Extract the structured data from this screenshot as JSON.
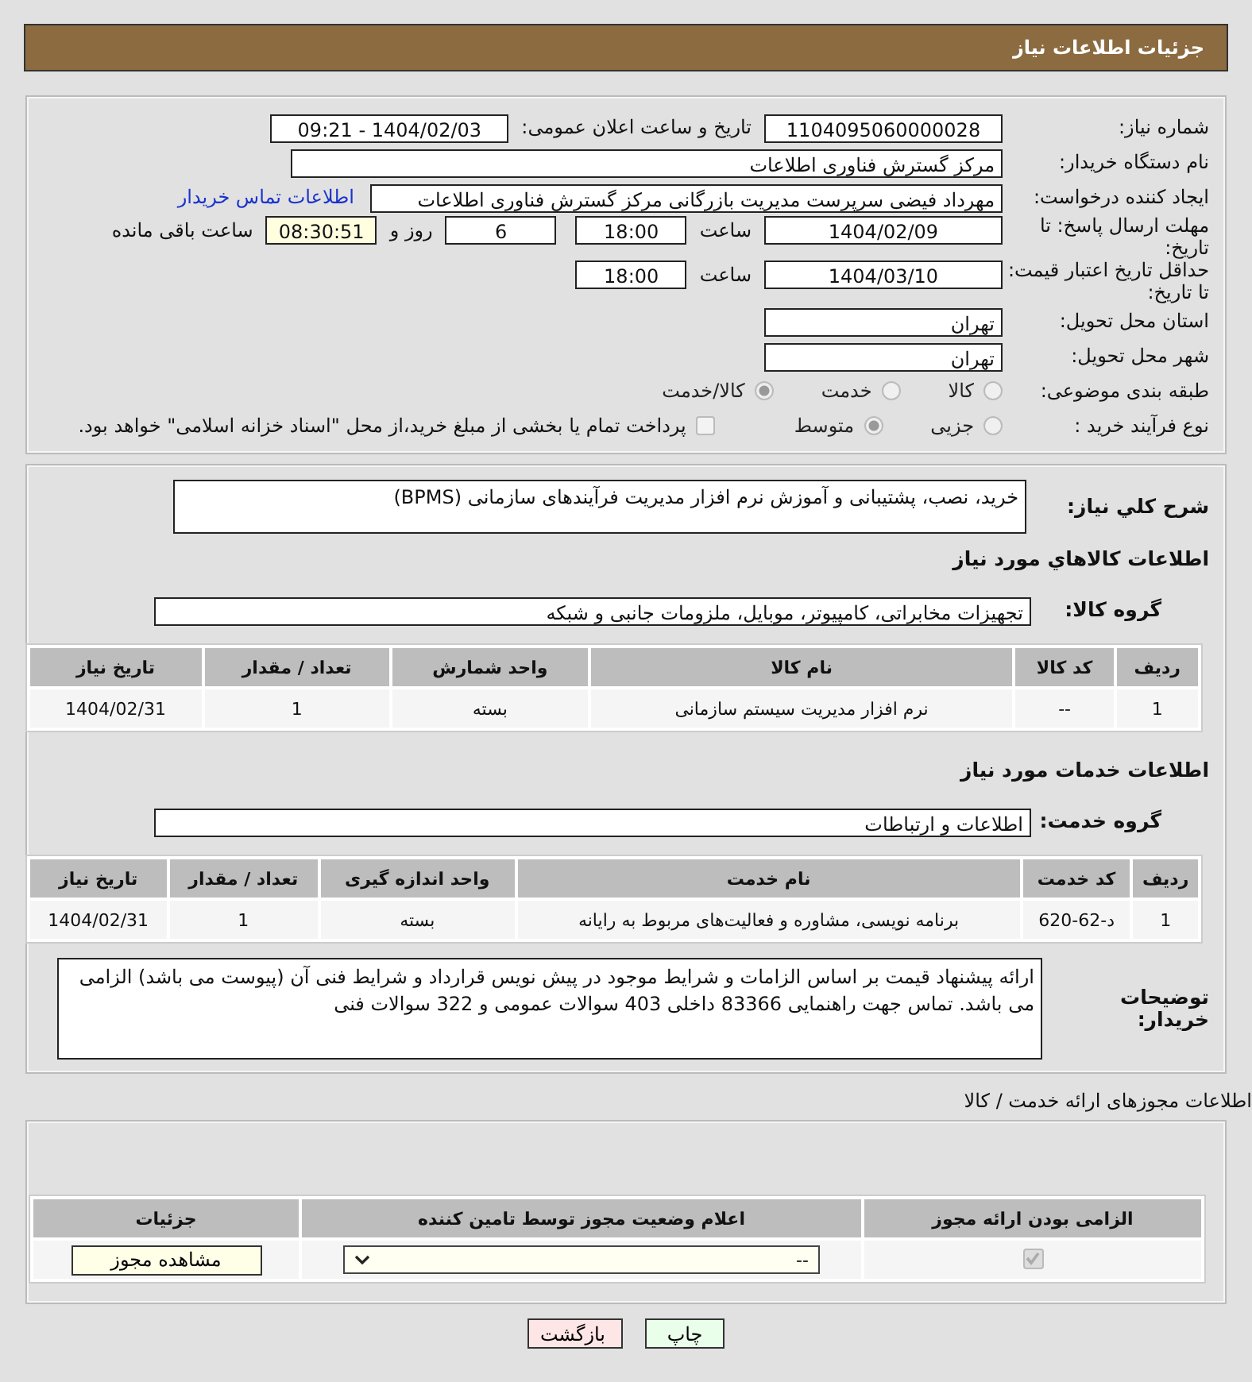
{
  "header": {
    "title": "جزئیات اطلاعات نیاز"
  },
  "need_number": {
    "label": "شماره نیاز:",
    "value": "1104095060000028"
  },
  "announce": {
    "label": "تاریخ و ساعت اعلان عمومی:",
    "value": "1404/02/03 - 09:21"
  },
  "buyer_org": {
    "label": "نام دستگاه خریدار:",
    "value": "مرکز گسترش فناوری اطلاعات"
  },
  "requester": {
    "label": "ایجاد کننده درخواست:",
    "value": "مهرداد فیضی سرپرست مدیریت بازرگانی مرکز گسترش فناوری اطلاعات",
    "link": "اطلاعات تماس خریدار"
  },
  "deadline": {
    "label": "مهلت ارسال پاسخ: تا تاریخ:",
    "date": "1404/02/09",
    "time_label": "ساعت",
    "time": "18:00",
    "days": "6",
    "days_label": "روز و",
    "remaining": "08:30:51",
    "remaining_label": "ساعت باقی مانده"
  },
  "price_validity": {
    "label": "حداقل تاریخ اعتبار قیمت: تا تاریخ:",
    "date": "1404/03/10",
    "time_label": "ساعت",
    "time": "18:00"
  },
  "province": {
    "label": "استان محل تحویل:",
    "value": "تهران"
  },
  "city": {
    "label": "شهر محل تحویل:",
    "value": "تهران"
  },
  "category": {
    "label": "طبقه بندی موضوعی:",
    "options": [
      {
        "label": "کالا",
        "selected": false
      },
      {
        "label": "خدمت",
        "selected": false
      },
      {
        "label": "کالا/خدمت",
        "selected": true
      }
    ]
  },
  "process": {
    "label": "نوع فرآیند خرید :",
    "options": [
      {
        "label": "جزیی",
        "selected": false
      },
      {
        "label": "متوسط",
        "selected": true
      }
    ],
    "payment": {
      "label": "پرداخت تمام یا بخشی از مبلغ خرید،از محل \"اسناد خزانه اسلامی\" خواهد بود.",
      "checked": false
    }
  },
  "description": {
    "label": "شرح کلي نیاز:",
    "value": "خرید، نصب، پشتیبانی و آموزش نرم افزار مدیریت فرآیندهای سازمانی (BPMS)"
  },
  "goods": {
    "title": "اطلاعات کالاهاي مورد نیاز",
    "group_label": "گروه کالا:",
    "group_value": "تجهیزات مخابراتی، کامپیوتر، موبایل، ملزومات جانبی و شبکه",
    "columns": [
      "ردیف",
      "کد کالا",
      "نام کالا",
      "واحد شمارش",
      "تعداد / مقدار",
      "تاریخ نیاز"
    ],
    "rows": [
      [
        "1",
        "--",
        "نرم افزار مدیریت سیستم سازمانی",
        "بسته",
        "1",
        "1404/02/31"
      ]
    ]
  },
  "services": {
    "title": "اطلاعات خدمات مورد نیاز",
    "group_label": "گروه خدمت:",
    "group_value": "اطلاعات و ارتباطات",
    "columns": [
      "ردیف",
      "کد خدمت",
      "نام خدمت",
      "واحد اندازه گیری",
      "تعداد / مقدار",
      "تاریخ نیاز"
    ],
    "rows": [
      [
        "1",
        "د-62-620",
        "برنامه نویسی، مشاوره و فعالیت‌های مربوط به رایانه",
        "بسته",
        "1",
        "1404/02/31"
      ]
    ]
  },
  "buyer_notes": {
    "label": "توضیحات خریدار:",
    "value": "ارائه پیشنهاد قیمت بر اساس الزامات و شرایط موجود در پیش نویس قرارداد و شرایط فنی آن (پیوست می باشد) الزامی می باشد. تماس جهت راهنمایی 83366 داخلی 403 سوالات عمومی و 322 سوالات فنی"
  },
  "permits": {
    "title": "اطلاعات مجوزهای ارائه خدمت / کالا",
    "columns": [
      "الزامی بودن ارائه مجوز",
      "اعلام وضعیت مجوز توسط تامین کننده",
      "جزئیات"
    ],
    "rows": [
      {
        "required": true,
        "status": "--",
        "button": "مشاهده مجوز"
      }
    ]
  },
  "buttons": [
    {
      "label": "چاپ",
      "kind": "print"
    },
    {
      "label": "بازگشت",
      "kind": "back"
    }
  ]
}
